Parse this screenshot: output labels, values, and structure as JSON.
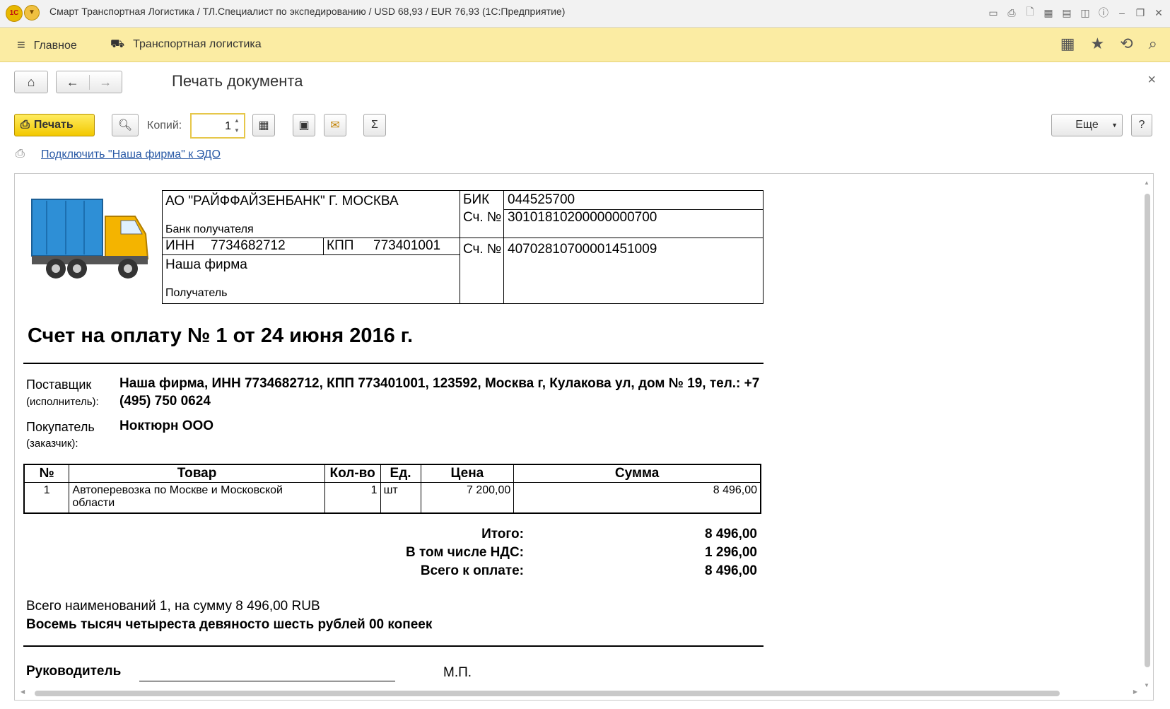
{
  "window": {
    "title": "Смарт Транспортная Логистика / ТЛ.Специалист по экспедированию / USD 68,93 / EUR 76,93  (1С:Предприятие)",
    "logo_text": "1С",
    "tools": [
      "save-icon",
      "print-icon",
      "preview-icon",
      "calculator-icon",
      "calendar-icon",
      "panels-icon",
      "info-icon",
      "minimize-icon",
      "restore-icon",
      "close-icon"
    ]
  },
  "sections": {
    "main": "Главное",
    "transport": "Транспортная логистика"
  },
  "form": {
    "title": "Печать документа"
  },
  "toolbar": {
    "print_label": "Печать",
    "copies_label": "Копий:",
    "copies_value": "1",
    "more_label": "Еще",
    "help_label": "?"
  },
  "edo_link": "Подключить \"Наша фирма\" к ЭДО",
  "document": {
    "bank": {
      "name": "АО \"РАЙФФАЙЗЕНБАНК\" Г. МОСКВА",
      "bank_label": "Банк получателя",
      "bik_label": "БИК",
      "bik": "044525700",
      "corr_label": "Сч. №",
      "corr_account": "30101810200000000700",
      "inn_label": "ИНН",
      "inn": "7734682712",
      "kpp_label": "КПП",
      "kpp": "773401001",
      "account_label": "Сч. №",
      "account": "40702810700001451009",
      "recipient_name": "Наша фирма",
      "recipient_label": "Получатель"
    },
    "title": "Счет на оплату № 1 от 24 июня 2016 г.",
    "supplier_label": "Поставщик",
    "supplier_sub": "(исполнитель):",
    "supplier_value": "Наша фирма,  ИНН 7734682712,  КПП 773401001,  123592, Москва г, Кулакова ул, дом № 19, тел.: +7 (495) 750 0624",
    "buyer_label": "Покупатель",
    "buyer_sub": "(заказчик):",
    "buyer_value": "Ноктюрн ООО",
    "table": {
      "headers": [
        "№",
        "Товар",
        "Кол-во",
        "Ед.",
        "Цена",
        "Сумма"
      ],
      "rows": [
        [
          "1",
          "Автоперевозка по Москве и Московской области",
          "1",
          "шт",
          "7 200,00",
          "8 496,00"
        ]
      ]
    },
    "totals": {
      "total_label": "Итого:",
      "total": "8 496,00",
      "vat_label": "В том числе НДС:",
      "vat": "1 296,00",
      "due_label": "Всего к оплате:",
      "due": "8 496,00"
    },
    "summary": "Всего наименований 1, на сумму 8 496,00 RUB",
    "summary_words": "Восемь тысяч четыреста девяносто шесть рублей 00 копеек",
    "signature_label": "Руководитель",
    "stamp_label": "М.П."
  }
}
